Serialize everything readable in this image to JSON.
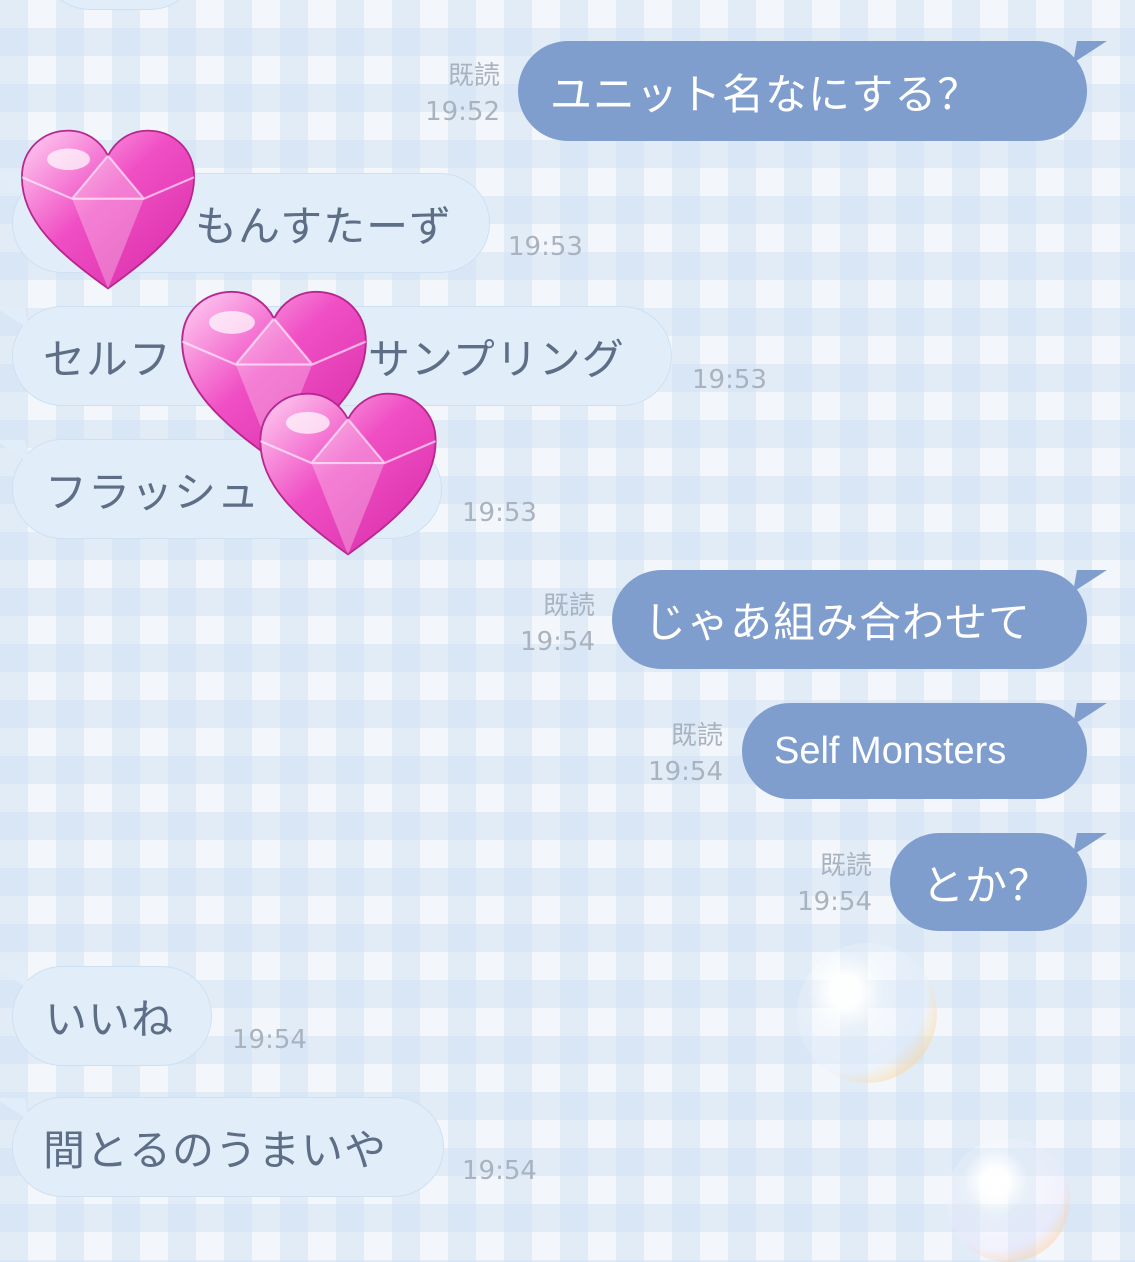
{
  "messages": [
    {
      "dir": "out",
      "text": "ユニット名なにする？",
      "read": "既読",
      "time": "19:52"
    },
    {
      "dir": "in",
      "text": "もんすたーず",
      "time": "19:53"
    },
    {
      "dir": "in",
      "text": "セルフ",
      "text2": "サンプリング",
      "time": "19:53"
    },
    {
      "dir": "in",
      "text": "フラッシュ",
      "time": "19:53"
    },
    {
      "dir": "out",
      "text": "じゃあ組み合わせて",
      "read": "既読",
      "time": "19:54"
    },
    {
      "dir": "out",
      "text": "Self Monsters",
      "read": "既読",
      "time": "19:54"
    },
    {
      "dir": "out",
      "text": "とか？",
      "read": "既読",
      "time": "19:54"
    },
    {
      "dir": "in",
      "text": "いいね",
      "time": "19:54"
    },
    {
      "dir": "in",
      "text": "間とるのうまいや",
      "time": "19:54"
    }
  ],
  "colors": {
    "outgoing_bubble": "#7f9ece",
    "incoming_bubble": "#e1eefa",
    "incoming_text": "#5d6e86",
    "meta_text": "#a9b3c0",
    "heart": "#f04fc4"
  },
  "decorations": [
    "heart-sticker",
    "heart-sticker",
    "heart-sticker",
    "soap-bubble",
    "soap-bubble"
  ]
}
